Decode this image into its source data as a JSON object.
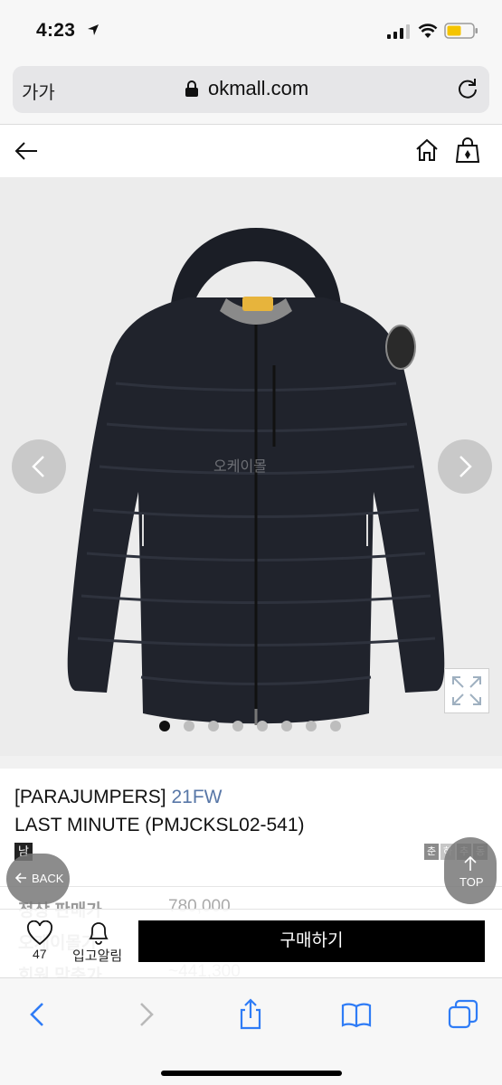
{
  "status_bar": {
    "time": "4:23"
  },
  "browser": {
    "text_size_button": "가가",
    "url": "okmall.com"
  },
  "image": {
    "watermark": "오케이몰",
    "dot_count": 8,
    "active_dot_index": 0
  },
  "product": {
    "brand": "[PARAJUMPERS]",
    "season": "21FW",
    "name": "LAST MINUTE (PMJCKSL02-541)",
    "gender_tag": "남",
    "season_tags": [
      "춘",
      "하",
      "추",
      "동"
    ],
    "season_colors": {
      "active": "#8b8b8b",
      "inactive": "#c7c7c7",
      "accent": "#5877a7"
    },
    "prices": [
      {
        "label": "정상 판매가",
        "value": "780,000"
      },
      {
        "label": "오케이몰가",
        "value": ""
      },
      {
        "label": "회원 맞춤가",
        "value": "~441,300"
      }
    ]
  },
  "floating": {
    "back_label": "BACK",
    "top_label": "TOP"
  },
  "buy_bar": {
    "like_count": "47",
    "restock_label": "입고알림",
    "buy_label": "구매하기"
  },
  "toolbar": {
    "icons": [
      "back-icon",
      "forward-icon",
      "share-icon",
      "bookmarks-icon",
      "tabs-icon"
    ]
  }
}
